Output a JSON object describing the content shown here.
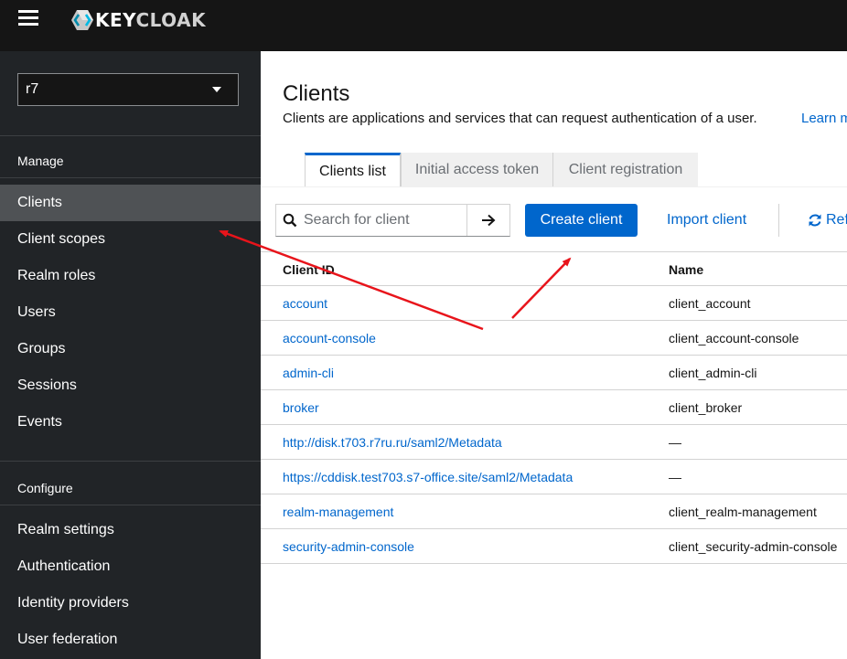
{
  "masthead": {
    "brand": "KEYCLOAK",
    "brand_key": "KEY",
    "brand_cloak": "CLOAK",
    "menu_icon": "hamburger-icon",
    "logo_icon": "keycloak-logo-icon"
  },
  "sidebar": {
    "realm": "r7",
    "manage_title": "Manage",
    "manage_items": [
      {
        "label": "Clients",
        "active": true
      },
      {
        "label": "Client scopes"
      },
      {
        "label": "Realm roles"
      },
      {
        "label": "Users"
      },
      {
        "label": "Groups"
      },
      {
        "label": "Sessions"
      },
      {
        "label": "Events"
      }
    ],
    "configure_title": "Configure",
    "configure_items": [
      {
        "label": "Realm settings"
      },
      {
        "label": "Authentication"
      },
      {
        "label": "Identity providers"
      },
      {
        "label": "User federation"
      }
    ]
  },
  "main": {
    "title": "Clients",
    "description": "Clients are applications and services that can request authentication of a user.",
    "learn_more": "Learn m",
    "tabs": [
      {
        "label": "Clients list",
        "active": true
      },
      {
        "label": "Initial access token"
      },
      {
        "label": "Client registration"
      }
    ],
    "toolbar": {
      "search_placeholder": "Search for client",
      "create_label": "Create client",
      "import_label": "Import client",
      "refresh_label": "Ref"
    },
    "table": {
      "headers": [
        "Client ID",
        "Name"
      ],
      "rows": [
        {
          "client_id": "account",
          "name": "client_account"
        },
        {
          "client_id": "account-console",
          "name": "client_account-console"
        },
        {
          "client_id": "admin-cli",
          "name": "client_admin-cli"
        },
        {
          "client_id": "broker",
          "name": "client_broker"
        },
        {
          "client_id": "http://disk.t703.r7ru.ru/saml2/Metadata",
          "name": "—"
        },
        {
          "client_id": "https://cddisk.test703.s7-office.site/saml2/Metadata",
          "name": "—"
        },
        {
          "client_id": "realm-management",
          "name": "client_realm-management"
        },
        {
          "client_id": "security-admin-console",
          "name": "client_security-admin-console"
        }
      ]
    }
  },
  "colors": {
    "masthead": "#151515",
    "sidebar": "#212427",
    "sidebar_active": "#4f5255",
    "primary": "#0066cc",
    "annotation_arrow": "#e8141b"
  }
}
